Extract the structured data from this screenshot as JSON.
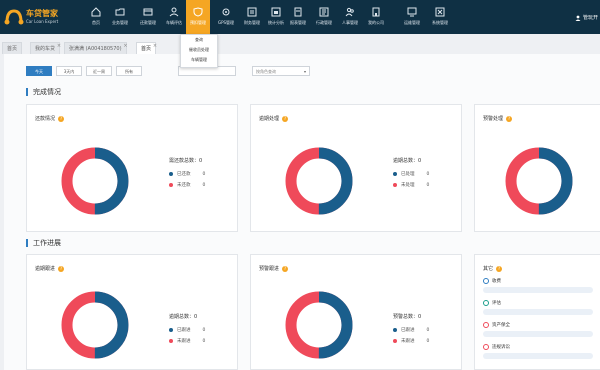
{
  "app": {
    "title": "车贷管家",
    "subtitle": "Car Loan Expert"
  },
  "nav": [
    {
      "label": "首页",
      "icon": "home-icon"
    },
    {
      "label": "业务管理",
      "icon": "folder-icon"
    },
    {
      "label": "还款管理",
      "icon": "repay-icon"
    },
    {
      "label": "车辆评估",
      "icon": "user-icon"
    },
    {
      "label": "预扣管理",
      "icon": "shield-icon",
      "active": true
    },
    {
      "label": "GPS管理",
      "icon": "gps-icon"
    },
    {
      "label": "财务管理",
      "icon": "finance-icon"
    },
    {
      "label": "统计分析",
      "icon": "chart-icon"
    },
    {
      "label": "报表管理",
      "icon": "report-icon"
    },
    {
      "label": "行政管理",
      "icon": "admin-icon"
    },
    {
      "label": "人事管理",
      "icon": "staff-icon"
    },
    {
      "label": "我的公司",
      "icon": "company-icon"
    },
    {
      "label": "运维管理",
      "icon": "monitor-icon"
    },
    {
      "label": "系统管理",
      "icon": "settings-icon"
    }
  ],
  "user": {
    "name": "管玩开"
  },
  "dropdown": {
    "items": [
      "查询",
      "催收员处理",
      "车辆管理"
    ]
  },
  "tabs": [
    {
      "label": "首页",
      "closable": false
    },
    {
      "label": "我的车贷",
      "closable": true
    },
    {
      "label": "张满满 (A004180570)",
      "closable": true
    },
    {
      "label": "首页",
      "closable": true,
      "active": true
    }
  ],
  "filters": {
    "buttons": [
      {
        "label": "今天",
        "active": true
      },
      {
        "label": "3天内"
      },
      {
        "label": "近一周"
      },
      {
        "label": "所有"
      }
    ],
    "select_placeholder": "按角色查询"
  },
  "sections": {
    "completion": "完成情况",
    "progress": "工作进展"
  },
  "colors": {
    "blue": "#1a5e8c",
    "red": "#ef4a5a",
    "accent": "#f5a623",
    "nav": "#0f3044"
  },
  "cards": [
    {
      "title": "还款情况",
      "total_label": "需还款总数：0",
      "items": [
        {
          "label": "已还款",
          "value": "0",
          "color": "#1a5e8c"
        },
        {
          "label": "未还款",
          "value": "0",
          "color": "#ef4a5a"
        }
      ],
      "blue_fraction": 0.5
    },
    {
      "title": "逾期处理",
      "total_label": "逾期总数：0",
      "items": [
        {
          "label": "已处理",
          "value": "0",
          "color": "#1a5e8c"
        },
        {
          "label": "未处理",
          "value": "0",
          "color": "#ef4a5a"
        }
      ],
      "blue_fraction": 0.5
    },
    {
      "title": "预警处理",
      "total_label": "",
      "items": [],
      "blue_fraction": 0.5
    },
    {
      "title": "逾期跟进",
      "total_label": "逾期总数：0",
      "items": [
        {
          "label": "已跟进",
          "value": "0",
          "color": "#1a5e8c"
        },
        {
          "label": "未跟进",
          "value": "0",
          "color": "#ef4a5a"
        }
      ],
      "blue_fraction": 0.5
    },
    {
      "title": "预警跟进",
      "total_label": "预警总数：0",
      "items": [
        {
          "label": "已跟进",
          "value": "0",
          "color": "#1a5e8c"
        },
        {
          "label": "未跟进",
          "value": "0",
          "color": "#ef4a5a"
        }
      ],
      "blue_fraction": 0.5
    }
  ],
  "other": {
    "title": "其它",
    "items": [
      {
        "label": "收费",
        "color": "#2f7dc1"
      },
      {
        "label": "评估",
        "color": "#1a9e8c"
      },
      {
        "label": "资产保全",
        "color": "#ef4a5a"
      },
      {
        "label": "违规诉讼",
        "color": "#ef4a5a"
      }
    ]
  }
}
